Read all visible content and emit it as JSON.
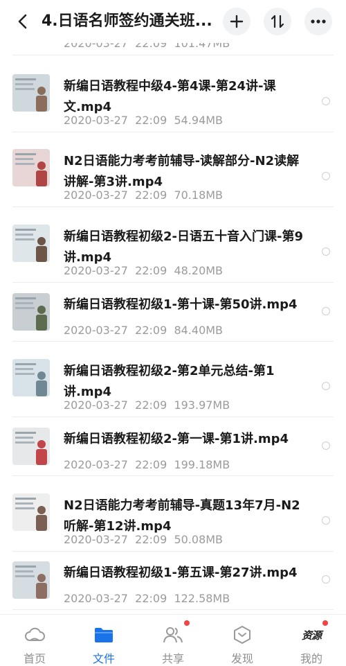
{
  "header": {
    "title": "4.日语名师签约通关班...",
    "icons": {
      "back": "chevron-left-icon",
      "add": "plus-icon",
      "sort": "sort-icon",
      "more": "more-icon"
    }
  },
  "partial_item": {
    "meta": "2020-03-27  22:09  101.47MB"
  },
  "files": [
    {
      "name": "新编日语教程中级4-第4课-第24讲-课文.mp4",
      "date": "2020-03-27",
      "time": "22:09",
      "size": "54.94MB"
    },
    {
      "name": "N2日语能力考考前辅导-读解部分-N2读解讲解-第3讲.mp4",
      "date": "2020-03-27",
      "time": "22:09",
      "size": "70.18MB"
    },
    {
      "name": "新编日语教程初级2-日语五十音入门课-第9讲.mp4",
      "date": "2020-03-27",
      "time": "22:09",
      "size": "48.20MB"
    },
    {
      "name": "新编日语教程初级1-第十课-第50讲.mp4",
      "date": "2020-03-27",
      "time": "22:09",
      "size": "84.40MB"
    },
    {
      "name": "新编日语教程初级2-第2单元总结-第1讲.mp4",
      "date": "2020-03-27",
      "time": "22:09",
      "size": "193.97MB"
    },
    {
      "name": "新编日语教程初级2-第一课-第1讲.mp4",
      "date": "2020-03-27",
      "time": "22:09",
      "size": "199.18MB"
    },
    {
      "name": "N2日语能力考考前辅导-真题13年7月-N2听解-第12讲.mp4",
      "date": "2020-03-27",
      "time": "22:09",
      "size": "50.08MB"
    },
    {
      "name": "新编日语教程初级1-第五课-第27讲.mp4",
      "date": "2020-03-27",
      "time": "22:09",
      "size": "122.58MB"
    }
  ],
  "tabbar": {
    "tabs": [
      {
        "label": "首页",
        "icon": "cloud-icon",
        "active": false,
        "badge": false
      },
      {
        "label": "文件",
        "icon": "folder-icon",
        "active": true,
        "badge": false
      },
      {
        "label": "共享",
        "icon": "people-icon",
        "active": false,
        "badge": true
      },
      {
        "label": "发现",
        "icon": "discover-icon",
        "active": false,
        "badge": false
      },
      {
        "label": "我的",
        "icon": "avatar-icon",
        "active": false,
        "badge": true
      }
    ],
    "avatar_text": "资源"
  },
  "colors": {
    "accent": "#1a73e8",
    "badge": "#ef4545",
    "meta_text": "#9b9b9b"
  }
}
